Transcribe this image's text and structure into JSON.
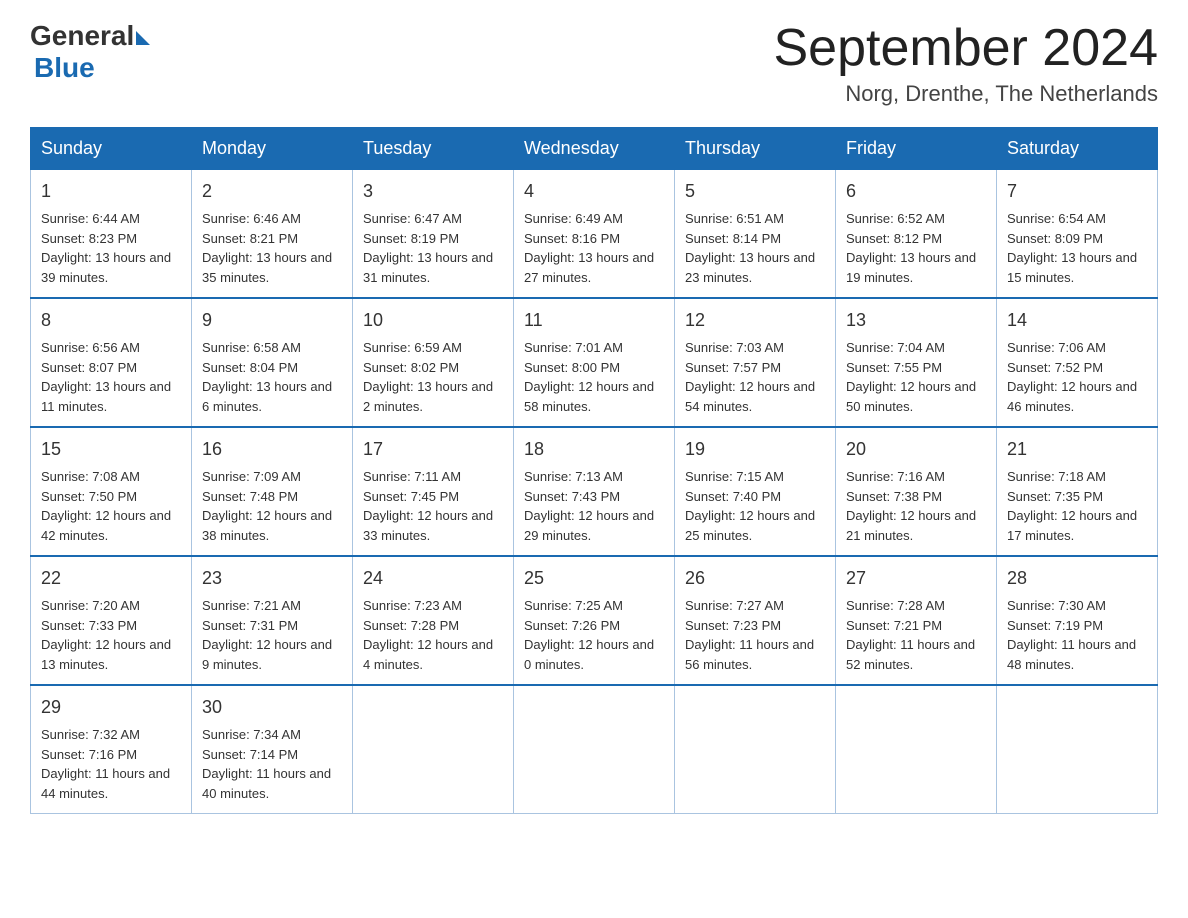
{
  "header": {
    "logo": {
      "general": "General",
      "blue": "Blue"
    },
    "title": "September 2024",
    "location": "Norg, Drenthe, The Netherlands"
  },
  "days": [
    "Sunday",
    "Monday",
    "Tuesday",
    "Wednesday",
    "Thursday",
    "Friday",
    "Saturday"
  ],
  "weeks": [
    [
      {
        "num": "1",
        "sunrise": "6:44 AM",
        "sunset": "8:23 PM",
        "daylight": "13 hours and 39 minutes."
      },
      {
        "num": "2",
        "sunrise": "6:46 AM",
        "sunset": "8:21 PM",
        "daylight": "13 hours and 35 minutes."
      },
      {
        "num": "3",
        "sunrise": "6:47 AM",
        "sunset": "8:19 PM",
        "daylight": "13 hours and 31 minutes."
      },
      {
        "num": "4",
        "sunrise": "6:49 AM",
        "sunset": "8:16 PM",
        "daylight": "13 hours and 27 minutes."
      },
      {
        "num": "5",
        "sunrise": "6:51 AM",
        "sunset": "8:14 PM",
        "daylight": "13 hours and 23 minutes."
      },
      {
        "num": "6",
        "sunrise": "6:52 AM",
        "sunset": "8:12 PM",
        "daylight": "13 hours and 19 minutes."
      },
      {
        "num": "7",
        "sunrise": "6:54 AM",
        "sunset": "8:09 PM",
        "daylight": "13 hours and 15 minutes."
      }
    ],
    [
      {
        "num": "8",
        "sunrise": "6:56 AM",
        "sunset": "8:07 PM",
        "daylight": "13 hours and 11 minutes."
      },
      {
        "num": "9",
        "sunrise": "6:58 AM",
        "sunset": "8:04 PM",
        "daylight": "13 hours and 6 minutes."
      },
      {
        "num": "10",
        "sunrise": "6:59 AM",
        "sunset": "8:02 PM",
        "daylight": "13 hours and 2 minutes."
      },
      {
        "num": "11",
        "sunrise": "7:01 AM",
        "sunset": "8:00 PM",
        "daylight": "12 hours and 58 minutes."
      },
      {
        "num": "12",
        "sunrise": "7:03 AM",
        "sunset": "7:57 PM",
        "daylight": "12 hours and 54 minutes."
      },
      {
        "num": "13",
        "sunrise": "7:04 AM",
        "sunset": "7:55 PM",
        "daylight": "12 hours and 50 minutes."
      },
      {
        "num": "14",
        "sunrise": "7:06 AM",
        "sunset": "7:52 PM",
        "daylight": "12 hours and 46 minutes."
      }
    ],
    [
      {
        "num": "15",
        "sunrise": "7:08 AM",
        "sunset": "7:50 PM",
        "daylight": "12 hours and 42 minutes."
      },
      {
        "num": "16",
        "sunrise": "7:09 AM",
        "sunset": "7:48 PM",
        "daylight": "12 hours and 38 minutes."
      },
      {
        "num": "17",
        "sunrise": "7:11 AM",
        "sunset": "7:45 PM",
        "daylight": "12 hours and 33 minutes."
      },
      {
        "num": "18",
        "sunrise": "7:13 AM",
        "sunset": "7:43 PM",
        "daylight": "12 hours and 29 minutes."
      },
      {
        "num": "19",
        "sunrise": "7:15 AM",
        "sunset": "7:40 PM",
        "daylight": "12 hours and 25 minutes."
      },
      {
        "num": "20",
        "sunrise": "7:16 AM",
        "sunset": "7:38 PM",
        "daylight": "12 hours and 21 minutes."
      },
      {
        "num": "21",
        "sunrise": "7:18 AM",
        "sunset": "7:35 PM",
        "daylight": "12 hours and 17 minutes."
      }
    ],
    [
      {
        "num": "22",
        "sunrise": "7:20 AM",
        "sunset": "7:33 PM",
        "daylight": "12 hours and 13 minutes."
      },
      {
        "num": "23",
        "sunrise": "7:21 AM",
        "sunset": "7:31 PM",
        "daylight": "12 hours and 9 minutes."
      },
      {
        "num": "24",
        "sunrise": "7:23 AM",
        "sunset": "7:28 PM",
        "daylight": "12 hours and 4 minutes."
      },
      {
        "num": "25",
        "sunrise": "7:25 AM",
        "sunset": "7:26 PM",
        "daylight": "12 hours and 0 minutes."
      },
      {
        "num": "26",
        "sunrise": "7:27 AM",
        "sunset": "7:23 PM",
        "daylight": "11 hours and 56 minutes."
      },
      {
        "num": "27",
        "sunrise": "7:28 AM",
        "sunset": "7:21 PM",
        "daylight": "11 hours and 52 minutes."
      },
      {
        "num": "28",
        "sunrise": "7:30 AM",
        "sunset": "7:19 PM",
        "daylight": "11 hours and 48 minutes."
      }
    ],
    [
      {
        "num": "29",
        "sunrise": "7:32 AM",
        "sunset": "7:16 PM",
        "daylight": "11 hours and 44 minutes."
      },
      {
        "num": "30",
        "sunrise": "7:34 AM",
        "sunset": "7:14 PM",
        "daylight": "11 hours and 40 minutes."
      },
      null,
      null,
      null,
      null,
      null
    ]
  ],
  "labels": {
    "sunrise": "Sunrise: ",
    "sunset": "Sunset: ",
    "daylight": "Daylight: "
  }
}
